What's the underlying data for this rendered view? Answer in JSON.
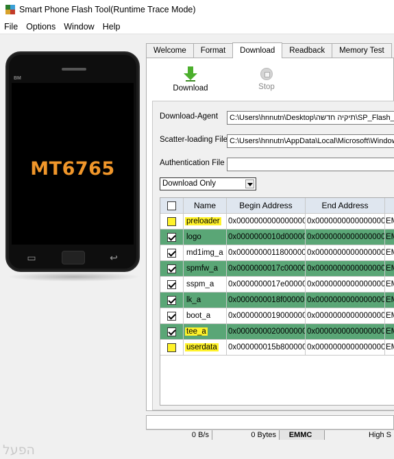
{
  "window": {
    "title": "Smart Phone Flash Tool(Runtime Trace Mode)"
  },
  "menu": [
    "File",
    "Options",
    "Window",
    "Help"
  ],
  "phone": {
    "brand": "BM",
    "chip": "MT6765"
  },
  "tabs": [
    "Welcome",
    "Format",
    "Download",
    "Readback",
    "Memory Test"
  ],
  "toolbar": {
    "download_label": "Download",
    "stop_label": "Stop"
  },
  "form": {
    "download_agent_label": "Download-Agent",
    "download_agent_value": "C:\\Users\\hnnutn\\Desktop\\תיקיה חדשה\\SP_Flash_",
    "scatter_label": "Scatter-loading File",
    "scatter_value": "C:\\Users\\hnnutn\\AppData\\Local\\Microsoft\\Window",
    "auth_label": "Authentication File",
    "auth_value": "",
    "mode_selected": "Download Only"
  },
  "grid": {
    "headers": [
      "",
      "Name",
      "Begin Address",
      "End Address",
      ""
    ],
    "rows": [
      {
        "checked": false,
        "name": "preloader",
        "begin": "0x0000000000000000",
        "end": "0x0000000000000000",
        "loc": "EM",
        "green": false,
        "highlight": true
      },
      {
        "checked": true,
        "name": "logo",
        "begin": "0x0000000010d00000",
        "end": "0x0000000000000000",
        "loc": "EM",
        "green": true,
        "highlight": false
      },
      {
        "checked": true,
        "name": "md1img_a",
        "begin": "0x0000000011800000",
        "end": "0x0000000000000000",
        "loc": "EM",
        "green": false,
        "highlight": false
      },
      {
        "checked": true,
        "name": "spmfw_a",
        "begin": "0x0000000017c00000",
        "end": "0x0000000000000000",
        "loc": "EM",
        "green": true,
        "highlight": false
      },
      {
        "checked": true,
        "name": "sspm_a",
        "begin": "0x0000000017e00000",
        "end": "0x0000000000000000",
        "loc": "EM",
        "green": false,
        "highlight": false
      },
      {
        "checked": true,
        "name": "lk_a",
        "begin": "0x0000000018f00000",
        "end": "0x0000000000000000",
        "loc": "EM",
        "green": true,
        "highlight": false
      },
      {
        "checked": true,
        "name": "boot_a",
        "begin": "0x0000000019000000",
        "end": "0x0000000000000000",
        "loc": "EM",
        "green": false,
        "highlight": false
      },
      {
        "checked": true,
        "name": "tee_a",
        "begin": "0x0000000020000000",
        "end": "0x0000000000000000",
        "loc": "EM",
        "green": true,
        "highlight": true
      },
      {
        "checked": false,
        "name": "userdata",
        "begin": "0x000000015b800000",
        "end": "0x0000000000000000",
        "loc": "EM",
        "green": false,
        "highlight": true
      }
    ]
  },
  "status": {
    "speed": "0 B/s",
    "bytes": "0 Bytes",
    "storage": "EMMC",
    "mode": "High S"
  },
  "watermark": "הפעל",
  "colors": {
    "row_green": "#5aa676",
    "highlight_yellow": "#fff22a",
    "chip_orange": "#f0962a",
    "header_blue": "#dfe6ef"
  }
}
